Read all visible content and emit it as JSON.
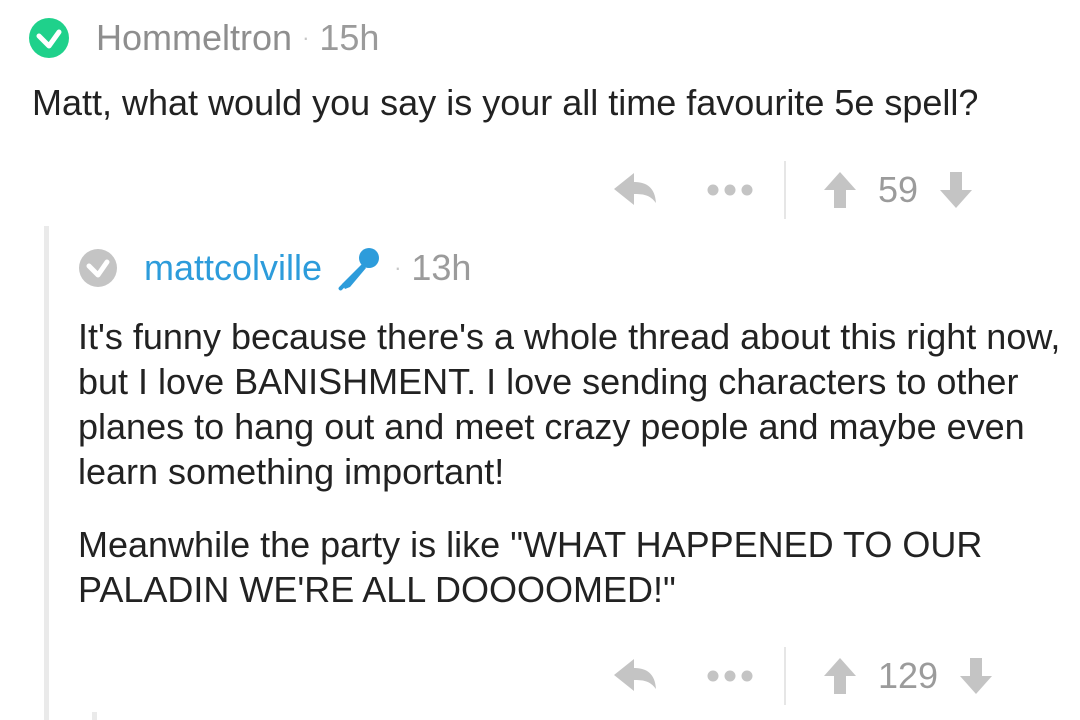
{
  "colors": {
    "op_badge": "#1fd18b",
    "reply_badge": "#c4c4c4",
    "reply_author": "#2d9cdb",
    "icon_gray": "#c4c4c4",
    "meta_gray": "#9b9b9b"
  },
  "comment_op": {
    "badge_icon": "check-circle-icon",
    "author": "Hommeltron",
    "separator": "·",
    "time": "15h",
    "body": "Matt, what would you say is your all time favourite 5e spell?",
    "score": "59",
    "icons": [
      "reply-arrow-icon",
      "more-options-icon",
      "upvote-arrow-icon",
      "downvote-arrow-icon"
    ]
  },
  "comment_reply": {
    "badge_icon": "check-circle-icon",
    "author": "mattcolville",
    "flair_icon": "microphone-icon",
    "separator": "·",
    "time": "13h",
    "paragraphs": [
      "It's funny because there's a whole thread about this right now, but I love BANISHMENT. I love sending characters to other planes to hang out and meet crazy people and maybe even learn something important!",
      "Meanwhile the party is like \"WHAT HAPPENED TO OUR PALADIN WE'RE ALL DOOOOMED!\""
    ],
    "score": "129",
    "icons": [
      "reply-arrow-icon",
      "more-options-icon",
      "upvote-arrow-icon",
      "downvote-arrow-icon"
    ]
  }
}
